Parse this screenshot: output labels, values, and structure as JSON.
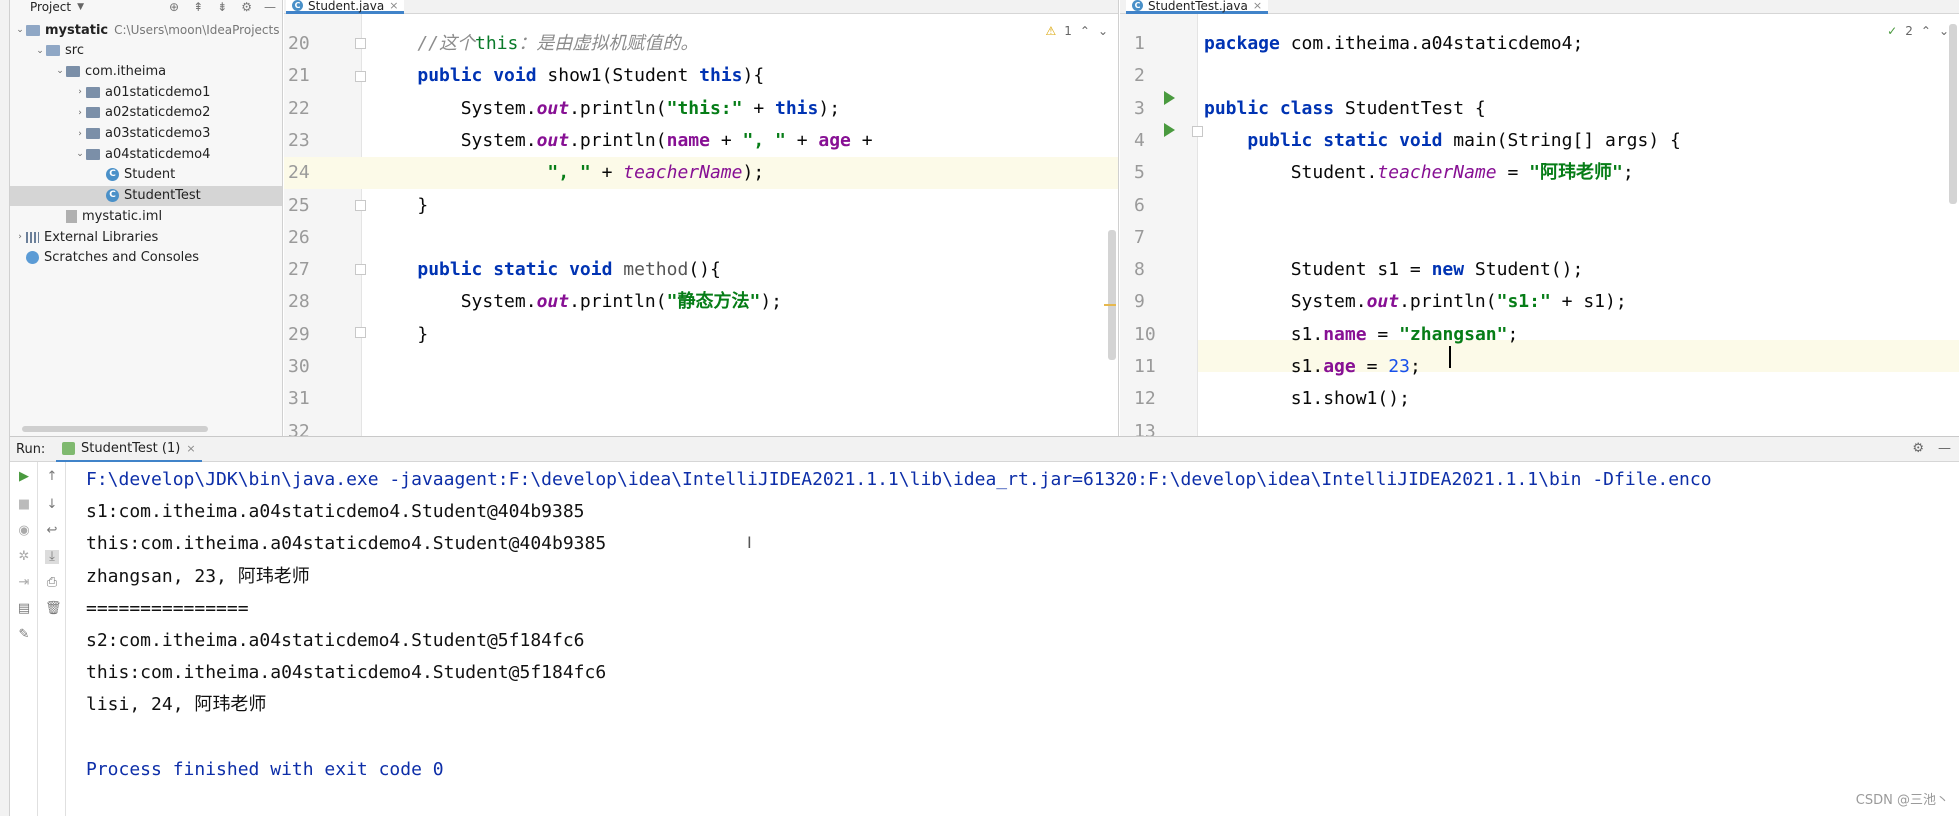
{
  "project": {
    "header_label": "Project",
    "items": [
      {
        "label": "mystatic",
        "path": "C:\\Users\\moon\\IdeaProjects",
        "kind": "module",
        "depth": 0,
        "expanded": true
      },
      {
        "label": "src",
        "kind": "folder",
        "depth": 1,
        "expanded": true
      },
      {
        "label": "com.itheima",
        "kind": "package",
        "depth": 2,
        "expanded": true
      },
      {
        "label": "a01staticdemo1",
        "kind": "package",
        "depth": 3,
        "expanded": false
      },
      {
        "label": "a02staticdemo2",
        "kind": "package",
        "depth": 3,
        "expanded": false
      },
      {
        "label": "a03staticdemo3",
        "kind": "package",
        "depth": 3,
        "expanded": false
      },
      {
        "label": "a04staticdemo4",
        "kind": "package",
        "depth": 3,
        "expanded": true
      },
      {
        "label": "Student",
        "kind": "class",
        "depth": 4
      },
      {
        "label": "StudentTest",
        "kind": "class",
        "depth": 4,
        "selected": true
      },
      {
        "label": "mystatic.iml",
        "kind": "file",
        "depth": 2
      },
      {
        "label": "External Libraries",
        "kind": "library",
        "depth": 0,
        "expanded": false
      },
      {
        "label": "Scratches and Consoles",
        "kind": "scratch",
        "depth": 0
      }
    ]
  },
  "editor_left": {
    "tab": "Student.java",
    "inspection": "1",
    "line_numbers": [
      "20",
      "21",
      "22",
      "23",
      "24",
      "25",
      "26",
      "27",
      "28",
      "29",
      "30",
      "31",
      "32"
    ],
    "lines": [
      [
        {
          "t": "    //这个",
          "c": "cmt"
        },
        {
          "t": "this",
          "c": "cmt2"
        },
        {
          "t": "：是由虚拟机赋值的。",
          "c": "cmt"
        }
      ],
      [
        {
          "t": "    ",
          "c": ""
        },
        {
          "t": "public void",
          "c": "kw"
        },
        {
          "t": " show1(Student ",
          "c": ""
        },
        {
          "t": "this",
          "c": "kw"
        },
        {
          "t": "){",
          "c": ""
        }
      ],
      [
        {
          "t": "        System.",
          "c": ""
        },
        {
          "t": "out",
          "c": "out"
        },
        {
          "t": ".println(",
          "c": ""
        },
        {
          "t": "\"this:\"",
          "c": "str"
        },
        {
          "t": " + ",
          "c": ""
        },
        {
          "t": "this",
          "c": "kw"
        },
        {
          "t": ");",
          "c": ""
        }
      ],
      [
        {
          "t": "        System.",
          "c": ""
        },
        {
          "t": "out",
          "c": "out"
        },
        {
          "t": ".println(",
          "c": ""
        },
        {
          "t": "name",
          "c": "fld"
        },
        {
          "t": " + ",
          "c": ""
        },
        {
          "t": "\", \"",
          "c": "str"
        },
        {
          "t": " + ",
          "c": ""
        },
        {
          "t": "age",
          "c": "fld"
        },
        {
          "t": " +",
          "c": ""
        }
      ],
      [
        {
          "t": "                ",
          "c": ""
        },
        {
          "t": "\", \"",
          "c": "str"
        },
        {
          "t": " + ",
          "c": ""
        },
        {
          "t": "teacherName",
          "c": "ital"
        },
        {
          "t": ");",
          "c": ""
        }
      ],
      [
        {
          "t": "    }",
          "c": ""
        }
      ],
      [
        {
          "t": "",
          "c": ""
        }
      ],
      [
        {
          "t": "    ",
          "c": ""
        },
        {
          "t": "public static void",
          "c": "kw"
        },
        {
          "t": " ",
          "c": ""
        },
        {
          "t": "method",
          "c": "meth"
        },
        {
          "t": "(){",
          "c": ""
        }
      ],
      [
        {
          "t": "        System.",
          "c": ""
        },
        {
          "t": "out",
          "c": "out"
        },
        {
          "t": ".println(",
          "c": ""
        },
        {
          "t": "\"静态方法\"",
          "c": "str"
        },
        {
          "t": ");",
          "c": ""
        }
      ],
      [
        {
          "t": "    }",
          "c": ""
        }
      ],
      [
        {
          "t": "",
          "c": ""
        }
      ],
      [
        {
          "t": "",
          "c": ""
        }
      ],
      [
        {
          "t": "",
          "c": ""
        }
      ]
    ]
  },
  "editor_right": {
    "tab": "StudentTest.java",
    "inspection": "2",
    "line_numbers": [
      "1",
      "2",
      "3",
      "4",
      "5",
      "6",
      "7",
      "8",
      "9",
      "10",
      "11",
      "12",
      "13"
    ],
    "lines": [
      [
        {
          "t": "package",
          "c": "kw"
        },
        {
          "t": " com.itheima.a04staticdemo4;",
          "c": ""
        }
      ],
      [
        {
          "t": "",
          "c": ""
        }
      ],
      [
        {
          "t": "public class",
          "c": "kw"
        },
        {
          "t": " StudentTest {",
          "c": ""
        }
      ],
      [
        {
          "t": "    ",
          "c": ""
        },
        {
          "t": "public static void",
          "c": "kw"
        },
        {
          "t": " main(String[] args) {",
          "c": ""
        }
      ],
      [
        {
          "t": "        Student.",
          "c": ""
        },
        {
          "t": "teacherName",
          "c": "ital"
        },
        {
          "t": " = ",
          "c": ""
        },
        {
          "t": "\"阿玮老师\"",
          "c": "str"
        },
        {
          "t": ";",
          "c": ""
        }
      ],
      [
        {
          "t": "",
          "c": ""
        }
      ],
      [
        {
          "t": "",
          "c": ""
        }
      ],
      [
        {
          "t": "        Student s1 = ",
          "c": ""
        },
        {
          "t": "new",
          "c": "kw"
        },
        {
          "t": " Student();",
          "c": ""
        }
      ],
      [
        {
          "t": "        System.",
          "c": ""
        },
        {
          "t": "out",
          "c": "out"
        },
        {
          "t": ".println(",
          "c": ""
        },
        {
          "t": "\"s1:\"",
          "c": "str"
        },
        {
          "t": " + s1);",
          "c": ""
        }
      ],
      [
        {
          "t": "        s1.",
          "c": ""
        },
        {
          "t": "name",
          "c": "fld"
        },
        {
          "t": " = ",
          "c": ""
        },
        {
          "t": "\"zhangsan\"",
          "c": "str"
        },
        {
          "t": ";",
          "c": ""
        }
      ],
      [
        {
          "t": "        s1.",
          "c": ""
        },
        {
          "t": "age",
          "c": "fld"
        },
        {
          "t": " = ",
          "c": ""
        },
        {
          "t": "23",
          "c": "num"
        },
        {
          "t": ";",
          "c": ""
        }
      ],
      [
        {
          "t": "        s1.show1();",
          "c": ""
        }
      ],
      [
        {
          "t": "",
          "c": ""
        }
      ]
    ]
  },
  "run": {
    "label": "Run:",
    "tab": "StudentTest (1)",
    "lines": [
      {
        "t": "F:\\develop\\JDK\\bin\\java.exe -javaagent:F:\\develop\\idea\\IntelliJIDEA2021.1.1\\lib\\idea_rt.jar=61320:F:\\develop\\idea\\IntelliJIDEA2021.1.1\\bin -Dfile.enco",
        "c": "cmd"
      },
      {
        "t": "s1:com.itheima.a04staticdemo4.Student@404b9385",
        "c": ""
      },
      {
        "t": "this:com.itheima.a04staticdemo4.Student@404b9385",
        "c": ""
      },
      {
        "t": "zhangsan, 23, 阿玮老师",
        "c": ""
      },
      {
        "t": "===============",
        "c": ""
      },
      {
        "t": "s2:com.itheima.a04staticdemo4.Student@5f184fc6",
        "c": ""
      },
      {
        "t": "this:com.itheima.a04staticdemo4.Student@5f184fc6",
        "c": ""
      },
      {
        "t": "lisi, 24, 阿玮老师",
        "c": ""
      },
      {
        "t": "",
        "c": ""
      },
      {
        "t": "Process finished with exit code 0",
        "c": "exit"
      }
    ]
  },
  "watermark": "CSDN @三池丶"
}
